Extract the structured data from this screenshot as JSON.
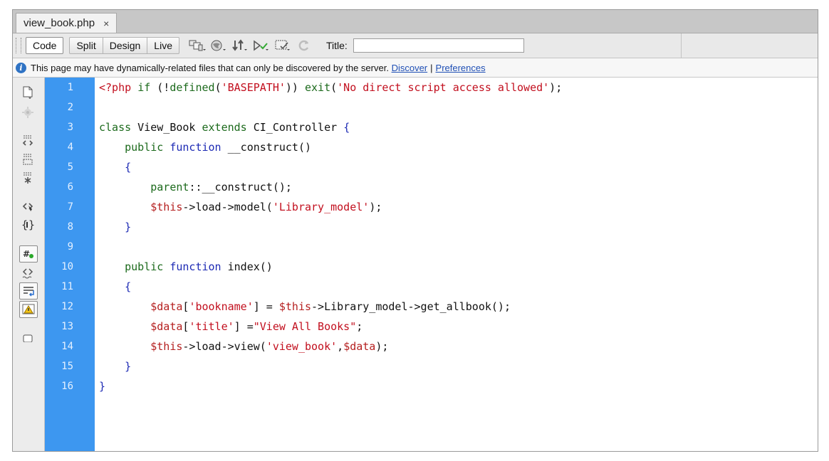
{
  "tab": {
    "label": "view_book.php",
    "close": "×"
  },
  "toolbar": {
    "view_buttons": [
      "Code",
      "Split",
      "Design",
      "Live"
    ],
    "title_label": "Title:",
    "title_value": "",
    "icons": [
      "multiscreen-icon",
      "preview-browser-icon",
      "file-management-icon",
      "w3c-validation-icon",
      "visual-aids-icon",
      "refresh-icon"
    ]
  },
  "info_bar": {
    "message": "This page may have dynamically-related files that can only be discovered by the server.",
    "discover_link": "Discover",
    "separator": "|",
    "preferences_link": "Preferences"
  },
  "side_tools": [
    "open-documents-icon",
    "show-code-navigator-icon",
    "collapse-full-tag-icon",
    "collapse-selection-icon",
    "expand-all-icon",
    "select-parent-tag-icon",
    "balance-braces-icon",
    "line-numbers-icon",
    "highlight-invalid-code-icon",
    "word-wrap-icon",
    "syntax-error-alerts-icon",
    "more-icon"
  ],
  "editor": {
    "line_numbers": [
      "1",
      "2",
      "3",
      "4",
      "5",
      "6",
      "7",
      "8",
      "9",
      "10",
      "11",
      "12",
      "13",
      "14",
      "15",
      "16"
    ],
    "lines": [
      [
        {
          "t": "<?php ",
          "c": "c-php"
        },
        {
          "t": "if",
          "c": "c-kw"
        },
        {
          "t": " (!",
          "c": "c-txt"
        },
        {
          "t": "defined",
          "c": "c-kw"
        },
        {
          "t": "(",
          "c": "c-txt"
        },
        {
          "t": "'BASEPATH'",
          "c": "c-str"
        },
        {
          "t": ")) ",
          "c": "c-txt"
        },
        {
          "t": "exit",
          "c": "c-kw"
        },
        {
          "t": "(",
          "c": "c-txt"
        },
        {
          "t": "'No direct script access allowed'",
          "c": "c-str"
        },
        {
          "t": ");",
          "c": "c-txt"
        }
      ],
      [],
      [
        {
          "t": "class",
          "c": "c-kw"
        },
        {
          "t": " View_Book ",
          "c": "c-txt"
        },
        {
          "t": "extends",
          "c": "c-kw"
        },
        {
          "t": " CI_Controller ",
          "c": "c-txt"
        },
        {
          "t": "{",
          "c": "c-brace"
        }
      ],
      [
        {
          "t": "    ",
          "c": "c-txt"
        },
        {
          "t": "public",
          "c": "c-kw"
        },
        {
          "t": " ",
          "c": "c-txt"
        },
        {
          "t": "function",
          "c": "c-fn"
        },
        {
          "t": " __construct()",
          "c": "c-txt"
        }
      ],
      [
        {
          "t": "    ",
          "c": "c-txt"
        },
        {
          "t": "{",
          "c": "c-brace"
        }
      ],
      [
        {
          "t": "        ",
          "c": "c-txt"
        },
        {
          "t": "parent",
          "c": "c-kw"
        },
        {
          "t": "::__construct();",
          "c": "c-txt"
        }
      ],
      [
        {
          "t": "        ",
          "c": "c-txt"
        },
        {
          "t": "$this",
          "c": "c-var"
        },
        {
          "t": "->load->model(",
          "c": "c-txt"
        },
        {
          "t": "'Library_model'",
          "c": "c-str"
        },
        {
          "t": ");",
          "c": "c-txt"
        }
      ],
      [
        {
          "t": "    ",
          "c": "c-txt"
        },
        {
          "t": "}",
          "c": "c-brace"
        }
      ],
      [],
      [
        {
          "t": "    ",
          "c": "c-txt"
        },
        {
          "t": "public",
          "c": "c-kw"
        },
        {
          "t": " ",
          "c": "c-txt"
        },
        {
          "t": "function",
          "c": "c-fn"
        },
        {
          "t": " index()",
          "c": "c-txt"
        }
      ],
      [
        {
          "t": "    ",
          "c": "c-txt"
        },
        {
          "t": "{",
          "c": "c-brace"
        }
      ],
      [
        {
          "t": "        ",
          "c": "c-txt"
        },
        {
          "t": "$data",
          "c": "c-var"
        },
        {
          "t": "[",
          "c": "c-txt"
        },
        {
          "t": "'bookname'",
          "c": "c-str"
        },
        {
          "t": "] = ",
          "c": "c-txt"
        },
        {
          "t": "$this",
          "c": "c-var"
        },
        {
          "t": "->Library_model->get_allbook();",
          "c": "c-txt"
        }
      ],
      [
        {
          "t": "        ",
          "c": "c-txt"
        },
        {
          "t": "$data",
          "c": "c-var"
        },
        {
          "t": "[",
          "c": "c-txt"
        },
        {
          "t": "'title'",
          "c": "c-str"
        },
        {
          "t": "] =",
          "c": "c-txt"
        },
        {
          "t": "\"View All Books\"",
          "c": "c-str"
        },
        {
          "t": ";",
          "c": "c-txt"
        }
      ],
      [
        {
          "t": "        ",
          "c": "c-txt"
        },
        {
          "t": "$this",
          "c": "c-var"
        },
        {
          "t": "->load->view(",
          "c": "c-txt"
        },
        {
          "t": "'view_book'",
          "c": "c-str"
        },
        {
          "t": ",",
          "c": "c-txt"
        },
        {
          "t": "$data",
          "c": "c-var"
        },
        {
          "t": ");",
          "c": "c-txt"
        }
      ],
      [
        {
          "t": "    ",
          "c": "c-txt"
        },
        {
          "t": "}",
          "c": "c-brace"
        }
      ],
      [
        {
          "t": "}",
          "c": "c-brace"
        }
      ]
    ]
  }
}
